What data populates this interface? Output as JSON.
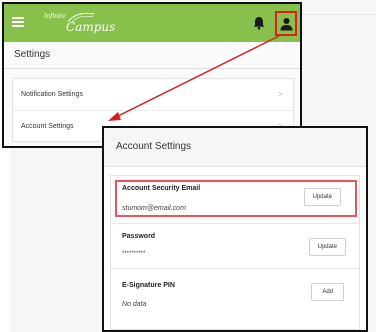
{
  "header": {
    "logo_small": "Infinite",
    "logo_big": "Campus"
  },
  "settings": {
    "title": "Settings",
    "items": [
      {
        "label": "Notification Settings",
        "chevron": ">"
      },
      {
        "label": "Account Settings",
        "chevron": ">"
      }
    ]
  },
  "account": {
    "title": "Account Settings",
    "rows": [
      {
        "label": "Account Security Email",
        "value": "stumom@email.com",
        "button": "Update"
      },
      {
        "label": "Password",
        "value": "**********",
        "button": "Update"
      },
      {
        "label": "E-Signature PIN",
        "value": "No data",
        "button": "Add"
      }
    ]
  },
  "colors": {
    "topbar": "#87c04a",
    "highlight": "#e21b1b"
  },
  "icons": [
    "menu-icon",
    "bell-icon",
    "user-icon",
    "chevron-right-icon"
  ]
}
